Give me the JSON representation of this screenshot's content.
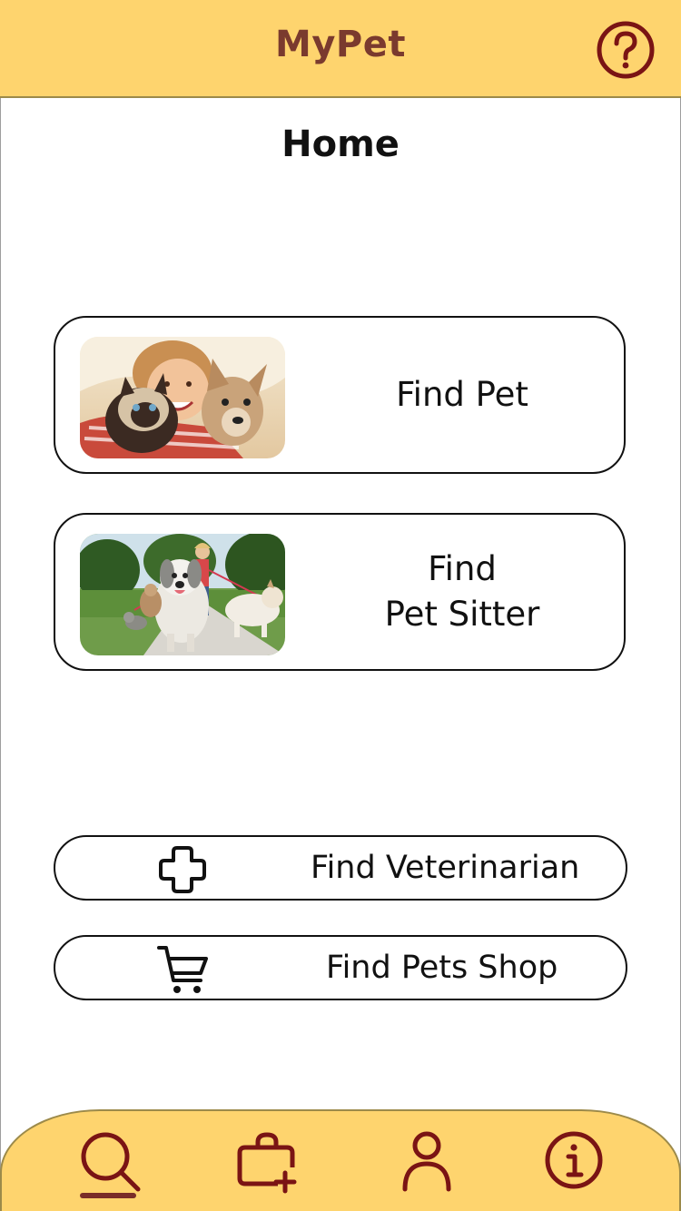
{
  "header": {
    "app_title": "MyPet",
    "help_icon": "help-circle-icon"
  },
  "page": {
    "title": "Home"
  },
  "cards": [
    {
      "label": "Find Pet",
      "image": "girl-with-cat-and-dog-photo"
    },
    {
      "label": "Find\nPet Sitter",
      "image": "woman-walking-dogs-photo"
    }
  ],
  "actions": [
    {
      "label": "Find Veterinarian",
      "icon": "medical-cross-icon"
    },
    {
      "label": "Find Pets Shop",
      "icon": "shopping-cart-icon"
    }
  ],
  "bottom_nav": {
    "items": [
      {
        "name": "search",
        "icon": "search-icon",
        "active": true
      },
      {
        "name": "add-to-bag",
        "icon": "bag-add-icon",
        "active": false
      },
      {
        "name": "profile",
        "icon": "user-icon",
        "active": false
      },
      {
        "name": "info",
        "icon": "info-circle-icon",
        "active": false
      }
    ]
  },
  "colors": {
    "accent": "#FED46E",
    "brand": "#7a3a2e",
    "icon": "#7a1414",
    "border": "#111111"
  }
}
